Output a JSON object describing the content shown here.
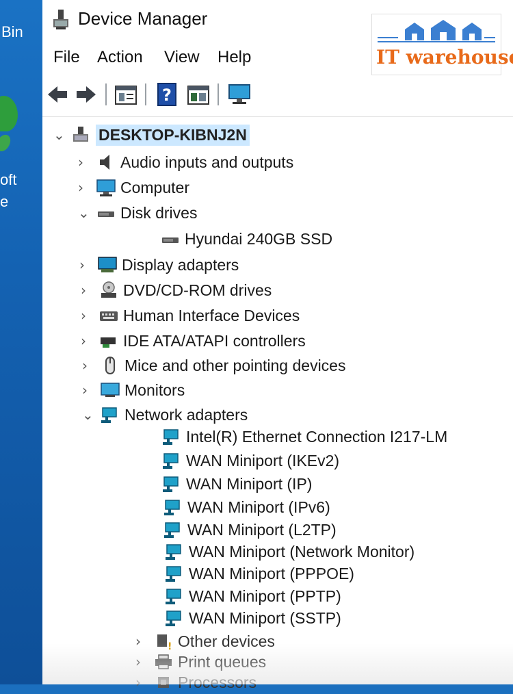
{
  "desktop": {
    "label_bin": "Bin",
    "label_oft": "oft",
    "label_e": "e"
  },
  "window": {
    "title": "Device Manager",
    "icon": "device-manager-icon"
  },
  "menu": {
    "file": "File",
    "action": "Action",
    "view": "View",
    "help": "Help"
  },
  "toolbar": {
    "buttons": [
      "back-arrow-icon",
      "forward-arrow-icon",
      "properties-icon",
      "help-icon",
      "update-driver-icon",
      "monitor-scan-icon"
    ]
  },
  "tree": {
    "root": "DESKTOP-KIBNJ2N",
    "audio": "Audio inputs and outputs",
    "computer": "Computer",
    "disk_drives": "Disk drives",
    "disk_child": "Hyundai 240GB SSD",
    "display": "Display adapters",
    "dvd": "DVD/CD-ROM drives",
    "hid": "Human Interface Devices",
    "ide": "IDE ATA/ATAPI controllers",
    "mice": "Mice and other pointing devices",
    "monitors": "Monitors",
    "network": "Network adapters",
    "net_children": [
      "Intel(R) Ethernet Connection I217-LM",
      "WAN Miniport (IKEv2)",
      "WAN Miniport (IP)",
      "WAN Miniport (IPv6)",
      "WAN Miniport (L2TP)",
      "WAN Miniport (Network Monitor)",
      "WAN Miniport (PPPOE)",
      "WAN Miniport (PPTP)",
      "WAN Miniport (SSTP)"
    ],
    "other": "Other devices",
    "print": "Print queues",
    "processors": "Processors"
  },
  "logo": {
    "text": "IT warehouse",
    "accent": "#e86a1a",
    "house_color": "#3b7fd1"
  },
  "colors": {
    "desktop": "#1b6fbe",
    "selection": "#cce8ff",
    "network_icon": "#1fa1c9"
  }
}
